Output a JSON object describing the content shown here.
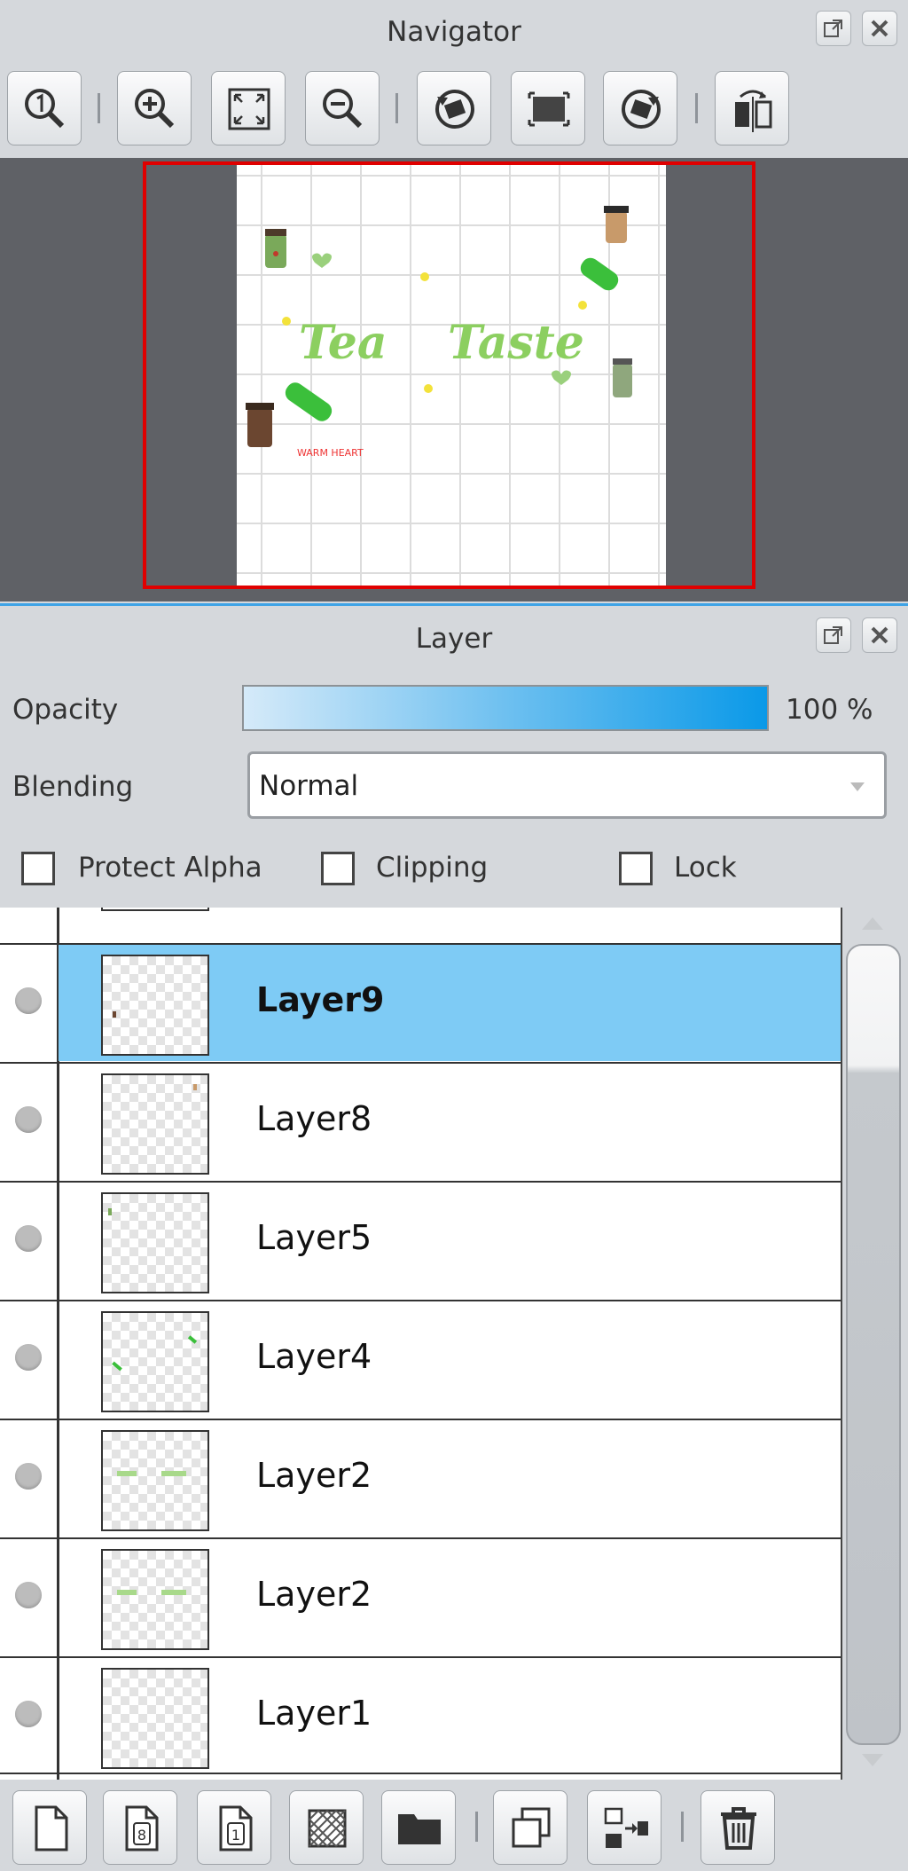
{
  "navigator": {
    "title": "Navigator",
    "toolbar": [
      "zoom-actual-icon",
      "zoom-in-icon",
      "fit-screen-icon",
      "zoom-out-icon",
      "rotate-left-icon",
      "reset-rotation-icon",
      "rotate-right-icon",
      "flip-horizontal-icon"
    ],
    "canvas_text": {
      "title_left": "Tea",
      "title_right": "Taste",
      "small": "WARM HEART"
    }
  },
  "layer_panel": {
    "title": "Layer",
    "opacity_label": "Opacity",
    "opacity_value": "100 %",
    "opacity_level": 1.0,
    "blending_label": "Blending",
    "blending_value": "Normal",
    "checkboxes": {
      "protect_alpha": "Protect Alpha",
      "clipping": "Clipping",
      "lock": "Lock"
    },
    "layers": [
      {
        "name": "Layer9",
        "selected": true
      },
      {
        "name": "Layer8",
        "selected": false
      },
      {
        "name": "Layer5",
        "selected": false
      },
      {
        "name": "Layer4",
        "selected": false
      },
      {
        "name": "Layer2",
        "selected": false
      },
      {
        "name": "Layer2",
        "selected": false
      },
      {
        "name": "Layer1",
        "selected": false
      }
    ],
    "bottom_toolbar": [
      "new-layer-icon",
      "new-8bit-layer-icon",
      "new-1bit-layer-icon",
      "new-halftone-layer-icon",
      "new-folder-icon",
      "duplicate-layer-icon",
      "merge-down-icon",
      "delete-layer-icon"
    ]
  },
  "colors": {
    "accent": "#3ea3e6",
    "selected_row": "#7ecbf5",
    "nav_frame": "#e00000"
  }
}
